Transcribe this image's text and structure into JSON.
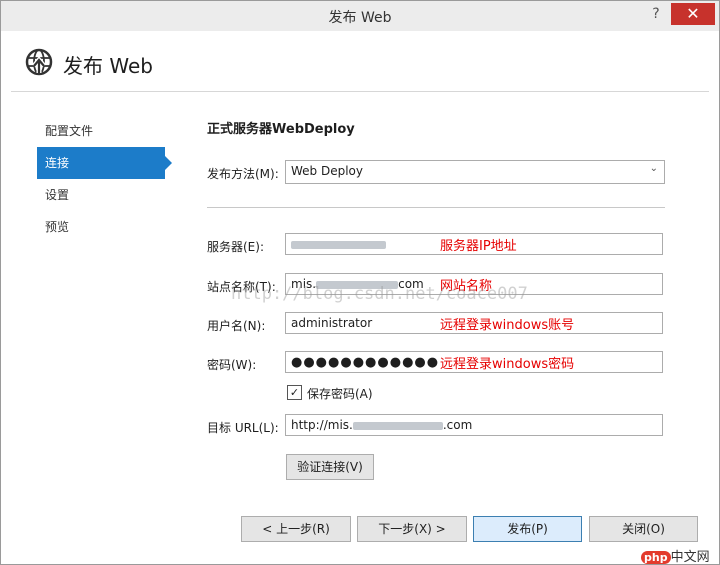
{
  "window": {
    "title": "发布 Web",
    "help": "?",
    "close": "✕"
  },
  "header": {
    "title": "发布 Web",
    "icon": "globe-publish-icon"
  },
  "sidebar": {
    "items": [
      {
        "label": "配置文件",
        "active": false
      },
      {
        "label": "连接",
        "active": true
      },
      {
        "label": "设置",
        "active": false
      },
      {
        "label": "预览",
        "active": false
      }
    ]
  },
  "form": {
    "section_title": "正式服务器WebDeploy",
    "method": {
      "label": "发布方法(M):",
      "value": "Web Deploy"
    },
    "server": {
      "label": "服务器(E):",
      "note": "服务器IP地址"
    },
    "site": {
      "label": "站点名称(T):",
      "value_prefix": "mis.",
      "value_suffix": "com",
      "note": "网站名称"
    },
    "user": {
      "label": "用户名(N):",
      "value": "administrator",
      "note": "远程登录windows账号"
    },
    "password": {
      "label": "密码(W):",
      "value": "●●●●●●●●●●●●",
      "note": "远程登录windows密码"
    },
    "save_password": {
      "label": "保存密码(A)",
      "checked": true
    },
    "target_url": {
      "label": "目标 URL(L):",
      "value_prefix": "http://mis.",
      "value_suffix": ".com"
    },
    "validate_button": "验证连接(V)"
  },
  "footer": {
    "prev": "< 上一步(R)",
    "next": "下一步(X) >",
    "publish": "发布(P)",
    "close": "关闭(O)"
  },
  "watermark": "http://blog.csdn.net/coace007",
  "logo": {
    "badge": "php",
    "text": "中文网"
  }
}
